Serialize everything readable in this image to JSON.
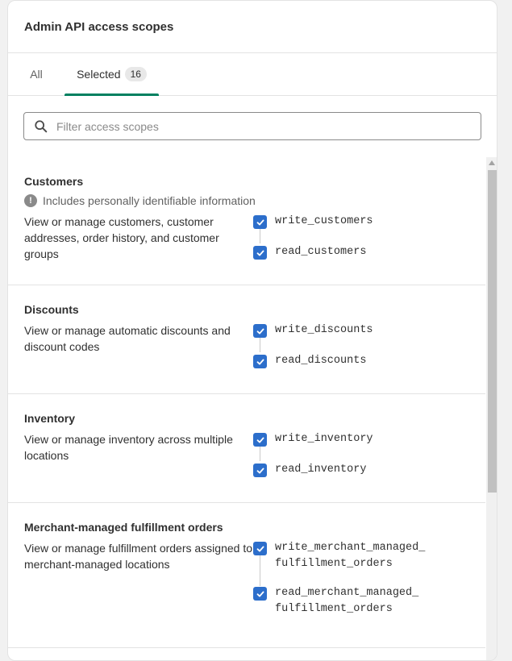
{
  "card": {
    "title": "Admin API access scopes"
  },
  "tabs": [
    {
      "label": "All"
    },
    {
      "label": "Selected",
      "badge": "16"
    }
  ],
  "search": {
    "placeholder": "Filter access scopes",
    "value": ""
  },
  "sections": [
    {
      "title": "Customers",
      "note": "Includes personally identifiable information",
      "description": "View or manage customers, customer addresses, order history, and customer groups",
      "scopes": [
        "write_customers",
        "read_customers"
      ]
    },
    {
      "title": "Discounts",
      "description": "View or manage automatic discounts and discount codes",
      "scopes": [
        "write_discounts",
        "read_discounts"
      ]
    },
    {
      "title": "Inventory",
      "description": "View or manage inventory across multiple locations",
      "scopes": [
        "write_inventory",
        "read_inventory"
      ]
    },
    {
      "title": "Merchant-managed fulfillment orders",
      "description": "View or manage fulfillment orders assigned to merchant-managed locations",
      "scopes": [
        "write_merchant_managed_\nfulfillment_orders",
        "read_merchant_managed_\nfulfillment_orders"
      ]
    }
  ],
  "colors": {
    "accent": "#008060",
    "checkbox": "#2c6ecb"
  }
}
